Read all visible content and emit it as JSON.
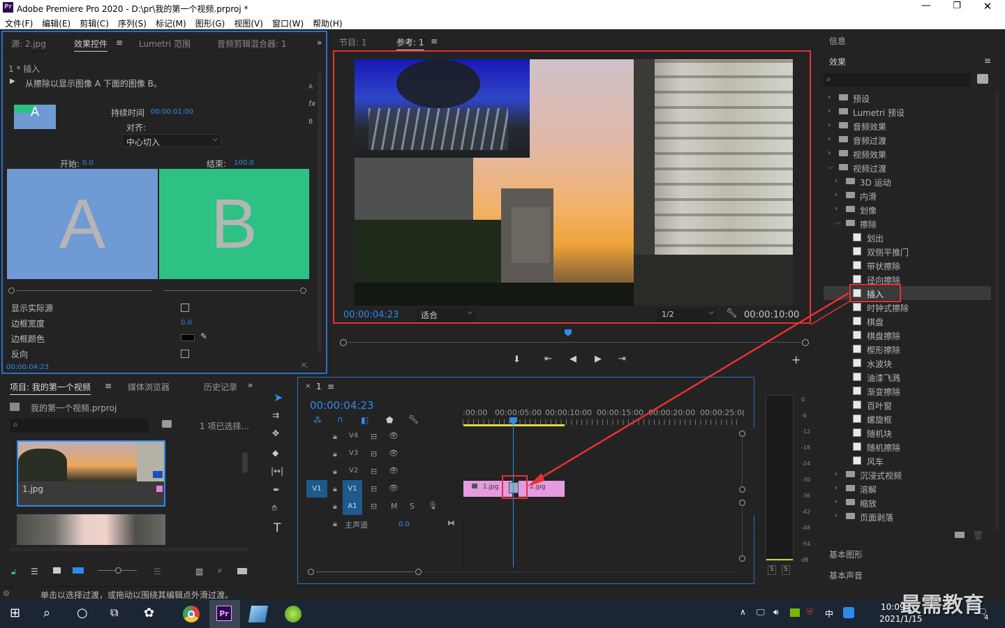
{
  "window": {
    "title": "Adobe Premiere Pro 2020 - D:\\pr\\我的第一个视频.prproj *",
    "app_icon": "Pr"
  },
  "menu": [
    "文件(F)",
    "编辑(E)",
    "剪辑(C)",
    "序列(S)",
    "标记(M)",
    "图形(G)",
    "视图(V)",
    "窗口(W)",
    "帮助(H)"
  ],
  "effect_controls": {
    "tabs": [
      "源: 2.jpg",
      "效果控件",
      "Lumetri 范围",
      "音频剪辑混合器: 1"
    ],
    "sequence_label": "1 * 插入",
    "description": "从擦除以显示图像 A 下面的图像 B。",
    "duration_label": "持续时间",
    "duration_value": "00:00:01:00",
    "align_label": "对齐:",
    "align_value": "中心切入",
    "start_label": "开始:",
    "start_value": "0.0",
    "end_label": "结束:",
    "end_value": "100.0",
    "a_label": "A",
    "b_label": "B",
    "show_actual_sources": "显示实际源",
    "border_width_label": "边框宽度",
    "border_width_value": "0.0",
    "border_color_label": "边框颜色",
    "reverse_label": "反向",
    "timecode": "00:00:04:23",
    "side_labels": [
      "A",
      "fx",
      "B"
    ]
  },
  "program_monitor": {
    "tabs": [
      "节目: 1",
      "参考: 1"
    ],
    "timecode": "00:00:04:23",
    "fit": "适合",
    "resolution": "1/2",
    "duration": "00:00:10:00"
  },
  "effects_panel": {
    "info_tab": "信息",
    "effects_tab": "效果",
    "tree": [
      {
        "label": "预设",
        "level": 0,
        "type": "folder",
        "open": false
      },
      {
        "label": "Lumetri 预设",
        "level": 0,
        "type": "folder",
        "open": false
      },
      {
        "label": "音频效果",
        "level": 0,
        "type": "folder",
        "open": false
      },
      {
        "label": "音频过渡",
        "level": 0,
        "type": "folder",
        "open": false
      },
      {
        "label": "视频效果",
        "level": 0,
        "type": "folder",
        "open": false
      },
      {
        "label": "视频过渡",
        "level": 0,
        "type": "folder",
        "open": true
      },
      {
        "label": "3D 运动",
        "level": 1,
        "type": "folder",
        "open": false
      },
      {
        "label": "内滑",
        "level": 1,
        "type": "folder",
        "open": false
      },
      {
        "label": "划像",
        "level": 1,
        "type": "folder",
        "open": false
      },
      {
        "label": "擦除",
        "level": 1,
        "type": "folder",
        "open": true
      },
      {
        "label": "划出",
        "level": 2,
        "type": "fx"
      },
      {
        "label": "双侧平推门",
        "level": 2,
        "type": "fx"
      },
      {
        "label": "带状擦除",
        "level": 2,
        "type": "fx"
      },
      {
        "label": "径向擦除",
        "level": 2,
        "type": "fx"
      },
      {
        "label": "插入",
        "level": 2,
        "type": "fx",
        "selected": true
      },
      {
        "label": "时钟式擦除",
        "level": 2,
        "type": "fx"
      },
      {
        "label": "棋盘",
        "level": 2,
        "type": "fx"
      },
      {
        "label": "棋盘擦除",
        "level": 2,
        "type": "fx"
      },
      {
        "label": "楔形擦除",
        "level": 2,
        "type": "fx"
      },
      {
        "label": "水波块",
        "level": 2,
        "type": "fx"
      },
      {
        "label": "油漆飞溅",
        "level": 2,
        "type": "fx"
      },
      {
        "label": "渐变擦除",
        "level": 2,
        "type": "fx"
      },
      {
        "label": "百叶窗",
        "level": 2,
        "type": "fx"
      },
      {
        "label": "螺旋框",
        "level": 2,
        "type": "fx"
      },
      {
        "label": "随机块",
        "level": 2,
        "type": "fx"
      },
      {
        "label": "随机擦除",
        "level": 2,
        "type": "fx"
      },
      {
        "label": "风车",
        "level": 2,
        "type": "fx"
      },
      {
        "label": "沉浸式视频",
        "level": 1,
        "type": "folder",
        "open": false
      },
      {
        "label": "溶解",
        "level": 1,
        "type": "folder",
        "open": false
      },
      {
        "label": "缩放",
        "level": 1,
        "type": "folder",
        "open": false
      },
      {
        "label": "页面剥落",
        "level": 1,
        "type": "folder",
        "open": false
      }
    ],
    "essential_graphics": "基本图形",
    "essential_sound": "基本声音"
  },
  "project": {
    "tabs": [
      "项目: 我的第一个视频",
      "媒体浏览器",
      "历史记录"
    ],
    "file": "我的第一个视频.prproj",
    "selection": "1 项已选择...",
    "item1": "1.jpg"
  },
  "timeline": {
    "tab": "1",
    "timecode": "00:00:04:23",
    "ruler": [
      ":00:00",
      "00:00:05:00",
      "00:00:10:00",
      "00:00:15:00",
      "00:00:20:00",
      "00:00:25:0("
    ],
    "tracks": [
      {
        "name": "V4"
      },
      {
        "name": "V3"
      },
      {
        "name": "V2"
      },
      {
        "name": "V1",
        "source": "V1"
      },
      {
        "name": "A1",
        "m": "M",
        "s": "S"
      }
    ],
    "master": "主声道",
    "master_value": "0.0",
    "clip1": "1.jpg",
    "clip2": "2.jpg"
  },
  "audio_meter": {
    "scale": [
      "0",
      "-6",
      "-12",
      "-18",
      "-24",
      "-30",
      "-36",
      "-42",
      "-48",
      "-54",
      "dB"
    ],
    "solo": [
      "S",
      "S"
    ]
  },
  "status": "单击以选择过渡，或拖动以围绕其编辑点外滑过渡。",
  "taskbar": {
    "time": "10:09",
    "date": "2021/1/15",
    "ime": "中",
    "watermark": "最需教育",
    "notif": "4"
  }
}
